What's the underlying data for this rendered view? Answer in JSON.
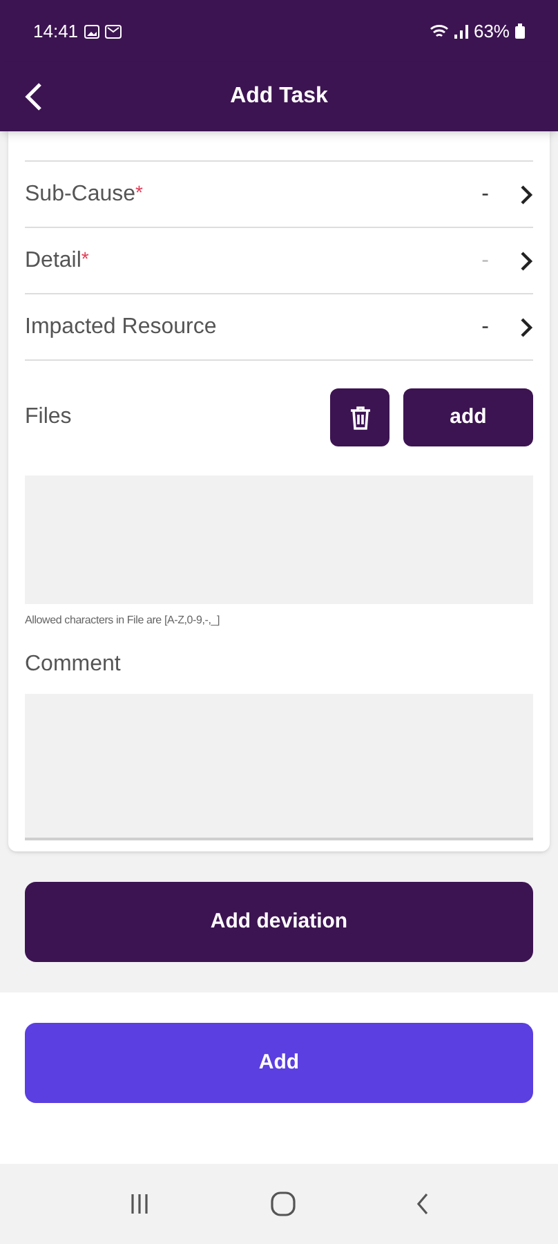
{
  "status_bar": {
    "time": "14:41",
    "battery": "63%"
  },
  "header": {
    "title": "Add Task"
  },
  "fields": [
    {
      "label": "Sub-Cause",
      "required_mark": "*",
      "value": "-",
      "disabled": false
    },
    {
      "label": "Detail",
      "required_mark": "*",
      "value": "-",
      "disabled": true
    },
    {
      "label": "Impacted Resource",
      "value": "-",
      "disabled": false
    }
  ],
  "files": {
    "label": "Files",
    "add_button": "add",
    "hint": "Allowed characters in File are [A-Z,0-9,-,_]"
  },
  "comment": {
    "label": "Comment"
  },
  "buttons": {
    "add_deviation": "Add deviation",
    "add": "Add"
  }
}
